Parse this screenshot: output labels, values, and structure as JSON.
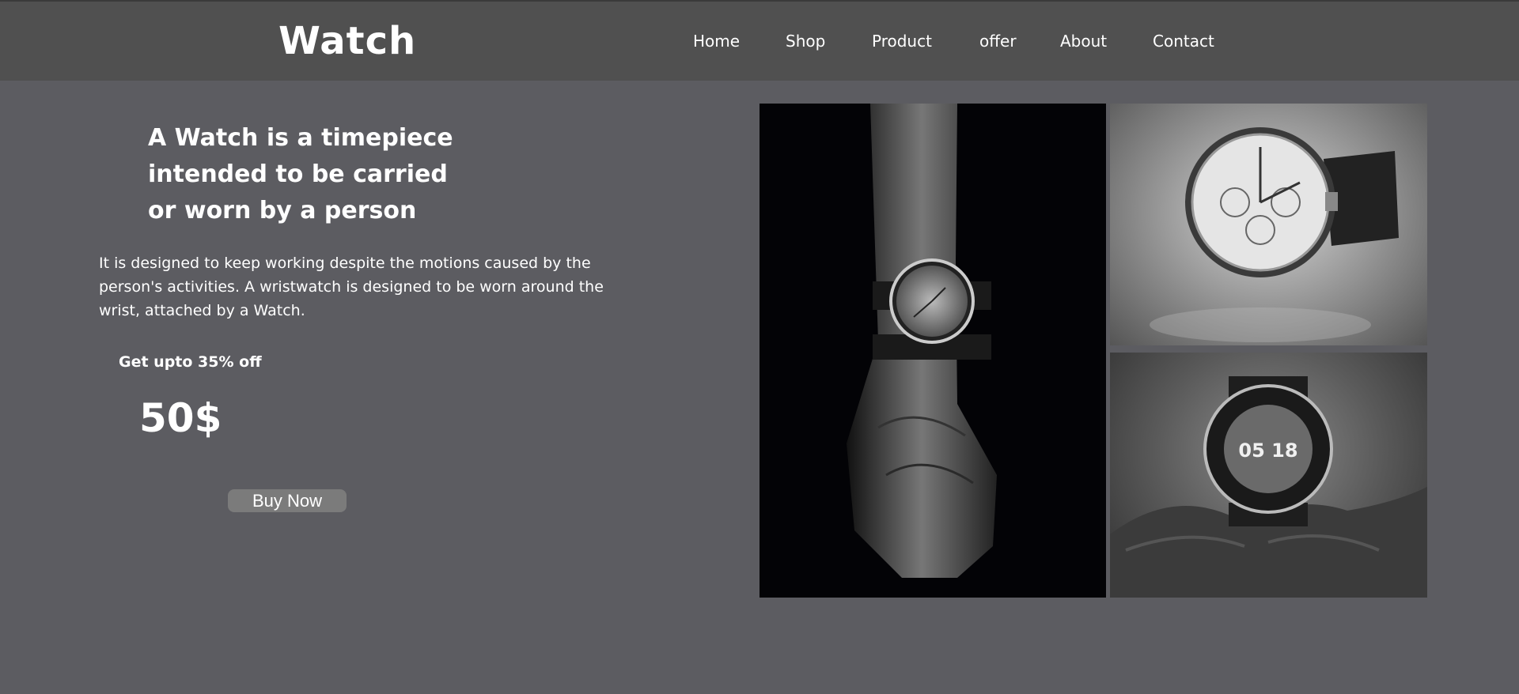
{
  "navbar": {
    "logo": "Watch",
    "items": [
      {
        "label": "Home"
      },
      {
        "label": "Shop"
      },
      {
        "label": "Product"
      },
      {
        "label": "offer"
      },
      {
        "label": "About"
      },
      {
        "label": "Contact"
      }
    ]
  },
  "hero": {
    "headline": "A Watch is a timepiece intended to be carried or worn by a person",
    "description": "It is designed to keep working despite the motions caused by the person's activities. A wristwatch is designed to be worn around the wrist, attached by a Watch.",
    "offer": "Get upto 35% off",
    "price": "50$",
    "cta": "Buy Now"
  },
  "gallery": {
    "smartwatch_display": "05 18"
  },
  "colors": {
    "page_background": "#5c5c61",
    "navbar_background": "#505050",
    "button_background": "#7b7b7b",
    "text": "#ffffff"
  }
}
